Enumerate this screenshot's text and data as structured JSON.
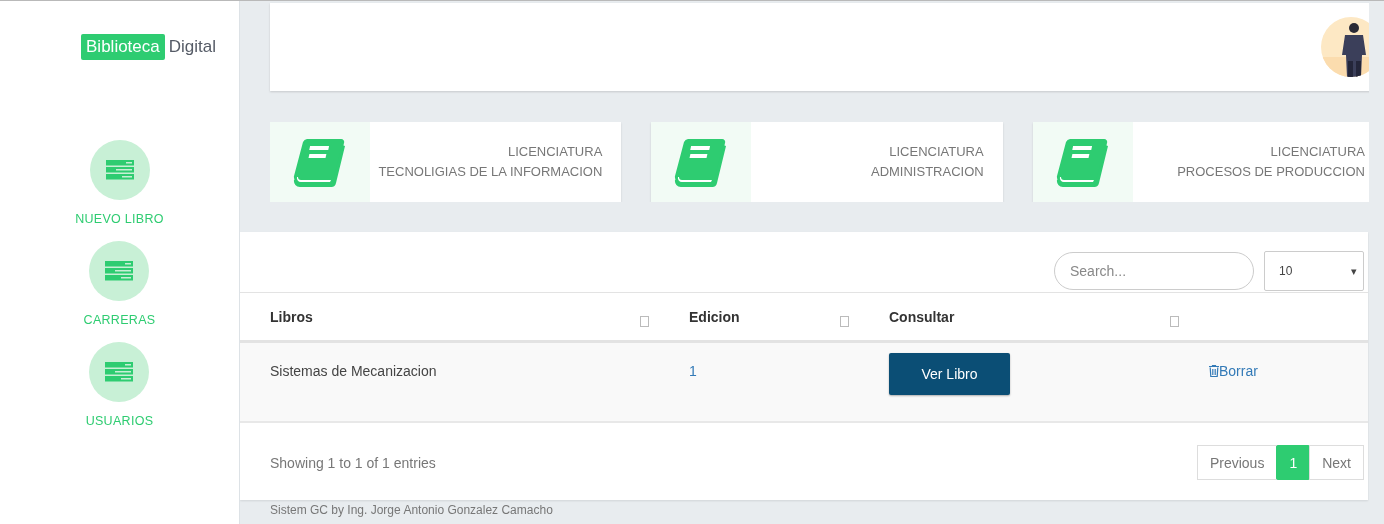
{
  "brand": {
    "highlight": "Biblioteca",
    "rest": "Digital"
  },
  "sidebar": {
    "items": [
      {
        "label": "NUEVO LIBRO"
      },
      {
        "label": "CARRERAS"
      },
      {
        "label": "USUARIOS"
      }
    ]
  },
  "programs": [
    {
      "line1": "LICENCIATURA",
      "line2": "TECNOLIGIAS DE LA INFORMACION"
    },
    {
      "line1": "LICENCIATURA",
      "line2": "ADMINISTRACION"
    },
    {
      "line1": "LICENCIATURA",
      "line2": "PROCESOS DE PRODUCCION"
    }
  ],
  "table": {
    "search": {
      "placeholder": "Search..."
    },
    "page_length": "10",
    "page_length_caret": "▾",
    "columns": [
      {
        "label": "Libros",
        "sortable": true
      },
      {
        "label": "Edicion",
        "sortable": true
      },
      {
        "label": "Consultar",
        "sortable": true
      }
    ],
    "rows": [
      {
        "libro": "Sistemas de Mecanizacion",
        "edicion": "1",
        "action": "Ver Libro",
        "delete": "Borrar"
      }
    ],
    "info": "Showing 1 to 1 of 1 entries",
    "pagination": [
      {
        "label": "Previous",
        "selected": false
      },
      {
        "label": "1",
        "selected": true
      },
      {
        "label": "Next",
        "selected": false
      }
    ]
  },
  "footer": "Sistem GC by Ing. Jorge Antonio Gonzalez Camacho"
}
